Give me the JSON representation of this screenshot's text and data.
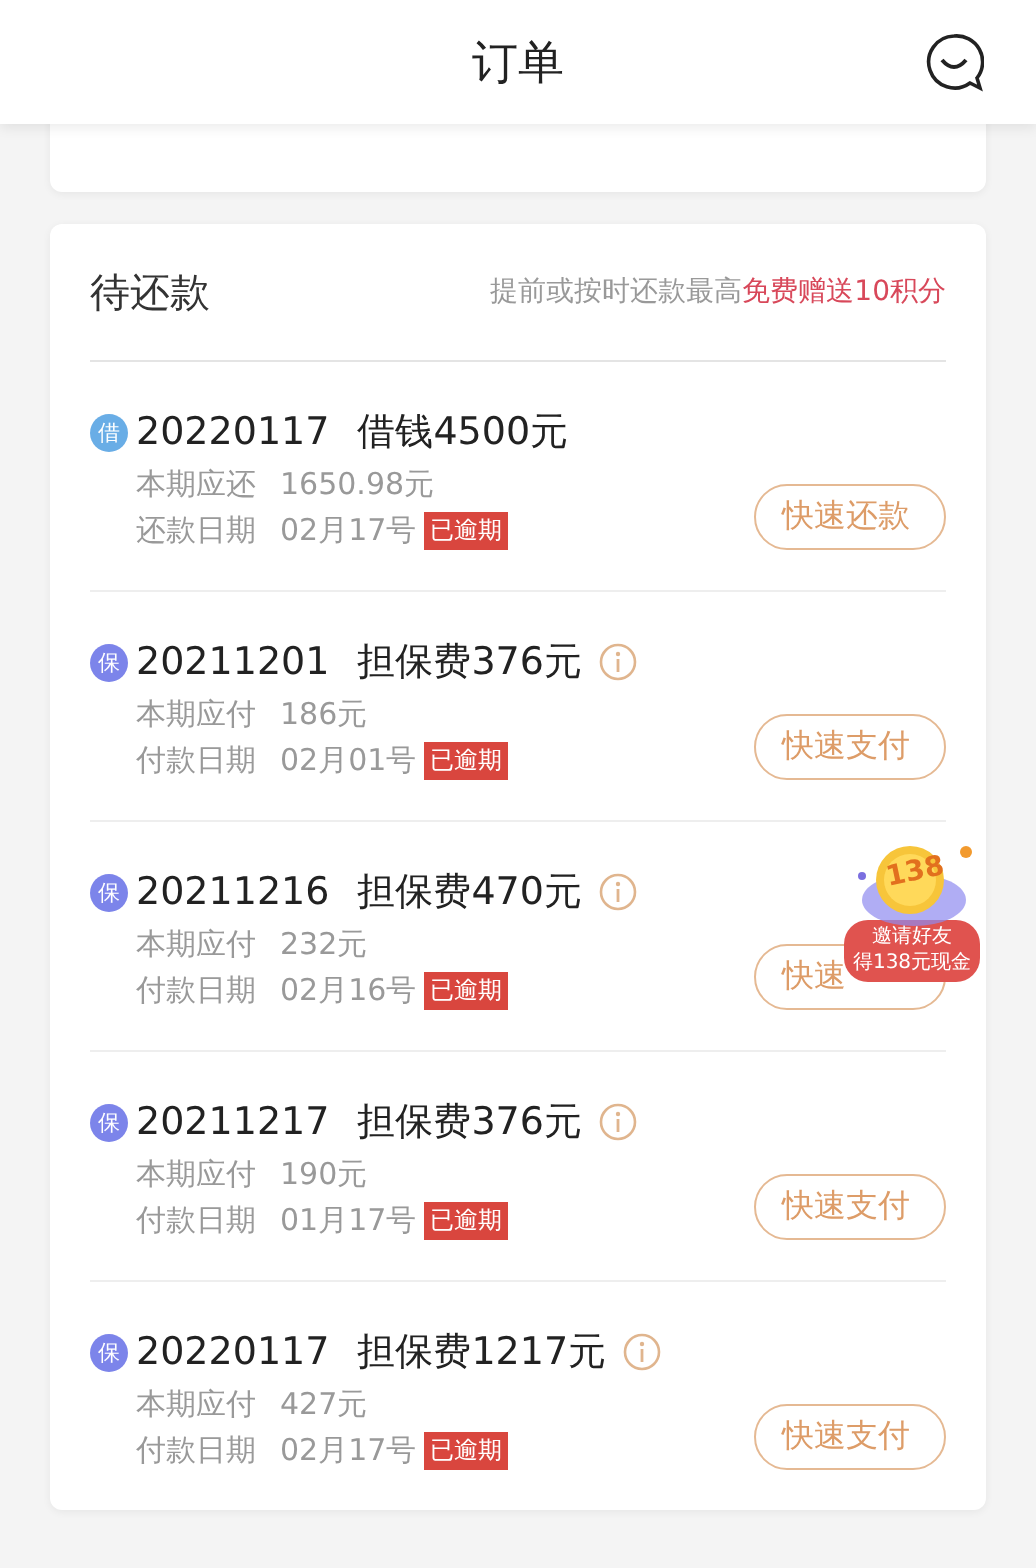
{
  "header": {
    "title": "订单"
  },
  "pending": {
    "title": "待还款",
    "notice": "提前或按时还款最高",
    "notice_highlight": "免费赠送10积分",
    "items": [
      {
        "badge": "借",
        "color": "#69ade6",
        "date": "20220117",
        "title": "借钱4500元",
        "info": false,
        "amount_label": "本期应还",
        "amount": "1650.98元",
        "due_label": "还款日期",
        "due": "02月17号",
        "tag": "已逾期",
        "action": "快速还款"
      },
      {
        "badge": "保",
        "color": "#7c84ea",
        "date": "20211201",
        "title": "担保费376元",
        "info": true,
        "amount_label": "本期应付",
        "amount": "186元",
        "due_label": "付款日期",
        "due": "02月01号",
        "tag": "已逾期",
        "action": "快速支付"
      },
      {
        "badge": "保",
        "color": "#7c84ea",
        "date": "20211216",
        "title": "担保费470元",
        "info": true,
        "amount_label": "本期应付",
        "amount": "232元",
        "due_label": "付款日期",
        "due": "02月16号",
        "tag": "已逾期",
        "action": "快速"
      },
      {
        "badge": "保",
        "color": "#7c84ea",
        "date": "20211217",
        "title": "担保费376元",
        "info": true,
        "amount_label": "本期应付",
        "amount": "190元",
        "due_label": "付款日期",
        "due": "01月17号",
        "tag": "已逾期",
        "action": "快速支付"
      },
      {
        "badge": "保",
        "color": "#7c84ea",
        "date": "20220117",
        "title": "担保费1217元",
        "info": true,
        "amount_label": "本期应付",
        "amount": "427元",
        "due_label": "付款日期",
        "due": "02月17号",
        "tag": "已逾期",
        "action": "快速支付"
      }
    ]
  },
  "promo": {
    "number": "138",
    "lines": [
      "邀请好友",
      "得138元现金"
    ]
  }
}
